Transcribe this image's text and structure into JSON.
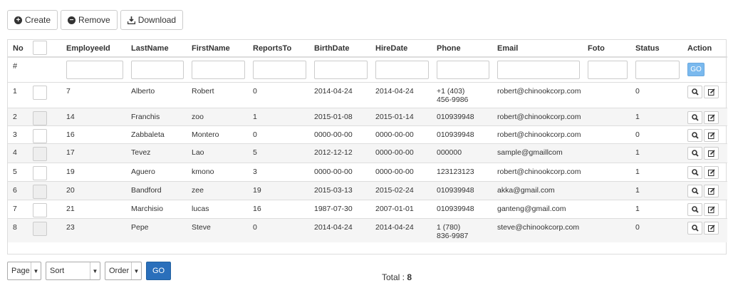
{
  "toolbar": {
    "create": "Create",
    "remove": "Remove",
    "download": "Download"
  },
  "columns": [
    "No",
    "",
    "EmployeeId",
    "LastName",
    "FirstName",
    "ReportsTo",
    "BirthDate",
    "HireDate",
    "Phone",
    "Email",
    "Foto",
    "Status",
    "Action"
  ],
  "filter": {
    "hash": "#",
    "go": "GO"
  },
  "rows": [
    {
      "no": "1",
      "id": "7",
      "last": "Alberto",
      "first": "Robert",
      "reports": "0",
      "birth": "2014-04-24",
      "hire": "2014-04-24",
      "phone": "+1 (403)",
      "phone2": "456-9986",
      "email": "robert@chinookcorp.com",
      "foto": "",
      "status": "0"
    },
    {
      "no": "2",
      "id": "14",
      "last": "Franchis",
      "first": "zoo",
      "reports": "1",
      "birth": "2015-01-08",
      "hire": "2015-01-14",
      "phone": "010939948",
      "phone2": "",
      "email": "robert@chinookcorp.com",
      "foto": "",
      "status": "1"
    },
    {
      "no": "3",
      "id": "16",
      "last": "Zabbaleta",
      "first": "Montero",
      "reports": "0",
      "birth": "0000-00-00",
      "hire": "0000-00-00",
      "phone": "010939948",
      "phone2": "",
      "email": "robert@chinookcorp.com",
      "foto": "",
      "status": "0"
    },
    {
      "no": "4",
      "id": "17",
      "last": "Tevez",
      "first": "Lao",
      "reports": "5",
      "birth": "2012-12-12",
      "hire": "0000-00-00",
      "phone": "000000",
      "phone2": "",
      "email": "sample@gmaillcom",
      "foto": "",
      "status": "1"
    },
    {
      "no": "5",
      "id": "19",
      "last": "Aguero",
      "first": "kmono",
      "reports": "3",
      "birth": "0000-00-00",
      "hire": "0000-00-00",
      "phone": "123123123",
      "phone2": "",
      "email": "robert@chinookcorp.com",
      "foto": "",
      "status": "1"
    },
    {
      "no": "6",
      "id": "20",
      "last": "Bandford",
      "first": "zee",
      "reports": "19",
      "birth": "2015-03-13",
      "hire": "2015-02-24",
      "phone": "010939948",
      "phone2": "",
      "email": "akka@gmail.com",
      "foto": "",
      "status": "1"
    },
    {
      "no": "7",
      "id": "21",
      "last": "Marchisio",
      "first": "lucas",
      "reports": "16",
      "birth": "1987-07-30",
      "hire": "2007-01-01",
      "phone": "010939948",
      "phone2": "",
      "email": "ganteng@gmail.com",
      "foto": "",
      "status": "1"
    },
    {
      "no": "8",
      "id": "23",
      "last": "Pepe",
      "first": "Steve",
      "reports": "0",
      "birth": "2014-04-24",
      "hire": "2014-04-24",
      "phone": "1 (780)",
      "phone2": "836-9987",
      "email": "steve@chinookcorp.com",
      "foto": "",
      "status": "0"
    }
  ],
  "footer": {
    "page": "Page",
    "sort": "Sort",
    "order": "Order",
    "go": "GO",
    "total_label": "Total :",
    "total_value": "8"
  }
}
